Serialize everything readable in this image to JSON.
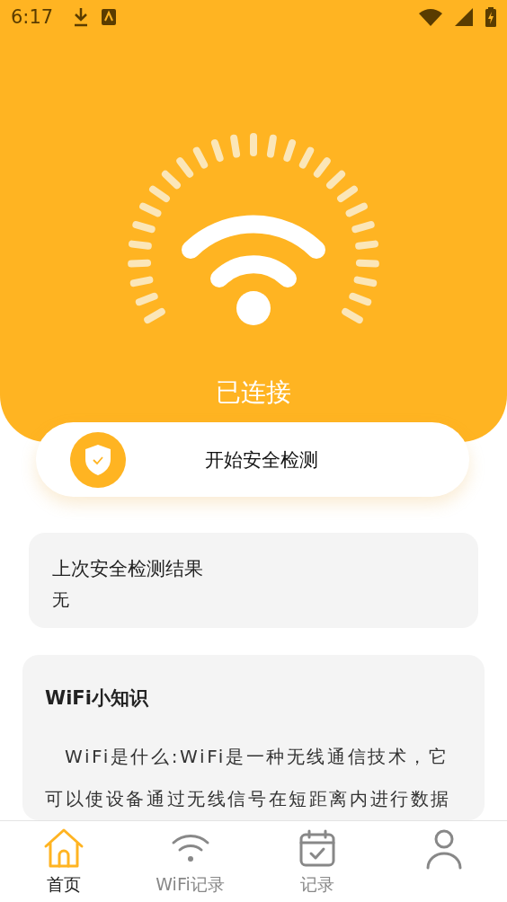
{
  "status_bar": {
    "time": "6:17"
  },
  "header": {
    "connection_status": "已连接"
  },
  "scan_button": {
    "label": "开始安全检测"
  },
  "last_result": {
    "title": "上次安全检测结果",
    "value": "无"
  },
  "knowledge": {
    "title": "WiFi小知识",
    "text": "WiFi是什么:WiFi是一种无线通信技术，它可以使设备通过无线信号在短距离内进行数据"
  },
  "tabs": [
    {
      "kind": "home",
      "label": "首页",
      "selected": true
    },
    {
      "kind": "wifi",
      "label": "WiFi记录",
      "selected": false
    },
    {
      "kind": "calendar",
      "label": "记录",
      "selected": false
    },
    {
      "kind": "person",
      "selected": false
    }
  ]
}
